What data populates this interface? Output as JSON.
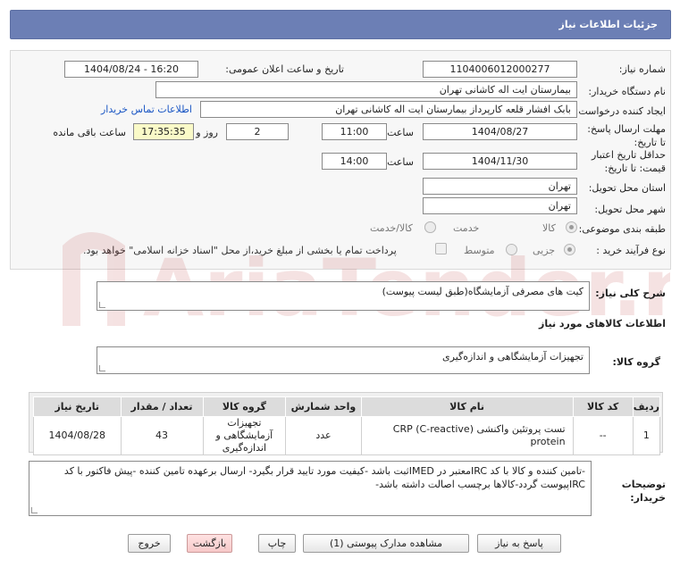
{
  "header": {
    "title": "جزئیات اطلاعات نیاز"
  },
  "form": {
    "need_number_label": "شماره نیاز:",
    "need_number": "1104006012000277",
    "announce_label": "تاریخ و ساعت اعلان عمومی:",
    "announce_value": "1404/08/24 - 16:20",
    "buyer_org_label": "نام دستگاه خریدار:",
    "buyer_org": "بیمارستان ایت اله کاشانی تهران",
    "requester_label": "ایجاد کننده درخواست:",
    "requester": "بابک افشار قلعه کارپرداز بیمارستان ایت اله کاشانی تهران",
    "buyer_contact_link": "اطلاعات تماس خریدار",
    "deadline_label": "مهلت ارسال پاسخ: تا تاریخ:",
    "deadline_date": "1404/08/27",
    "time_label": "ساعت",
    "deadline_time": "11:00",
    "days_value": "2",
    "days_label": "روز و",
    "remaining_time": "17:35:35",
    "remaining_label": "ساعت باقی مانده",
    "validity_label": "حداقل تاریخ اعتبار قیمت: تا تاریخ:",
    "validity_date": "1404/11/30",
    "validity_time": "14:00",
    "province_label": "استان محل تحویل:",
    "province": "تهران",
    "city_label": "شهر محل تحویل:",
    "city": "تهران",
    "category_label": "طبقه بندی موضوعی:",
    "category_options": [
      "کالا",
      "خدمت",
      "کالا/خدمت"
    ],
    "process_label": "نوع فرآیند خرید :",
    "process_options": [
      "جزیی",
      "متوسط"
    ],
    "payment_note": "پرداخت تمام یا بخشی از مبلغ خرید،از محل \"اسناد خزانه اسلامی\" خواهد بود."
  },
  "summary": {
    "label": "شرح کلی نیاز:",
    "value": "کیت های مصرفی آزمایشگاه(طبق لیست پیوست)"
  },
  "goods_info_title": "اطلاعات کالاهای مورد نیاز",
  "goods_group": {
    "label": "گروه کالا:",
    "value": "تجهیزات آزمایشگاهی و اندازه‌گیری"
  },
  "table": {
    "headers": [
      "ردیف",
      "کد کالا",
      "نام کالا",
      "واحد شمارش",
      "گروه کالا",
      "تعداد / مقدار",
      "تاریخ نیاز"
    ],
    "rows": [
      {
        "row": "1",
        "code": "--",
        "name": "تست پروتئین واکنشی (CRP (C-reactive protein",
        "unit": "عدد",
        "group": "تجهیزات آزمایشگاهی و اندازه‌گیری",
        "qty": "43",
        "date": "1404/08/28"
      }
    ]
  },
  "notes": {
    "label": "توضیحات خریدار:",
    "value": "-تامین کننده و کالا با کد IRCمعتبر در IMEDثبت باشد -کیفیت مورد تایید قرار بگیرد- ارسال برعهده تامین کننده -پیش فاکتور با کد IRCپیوست گردد-کالاها برچسب اصالت داشته باشد-"
  },
  "buttons": {
    "reply": "پاسخ به نیاز",
    "docs": "مشاهده مدارک پیوستی (1)",
    "print": "چاپ",
    "back": "بازگشت",
    "exit": "خروج"
  },
  "watermark_text": "AriaTender.net"
}
